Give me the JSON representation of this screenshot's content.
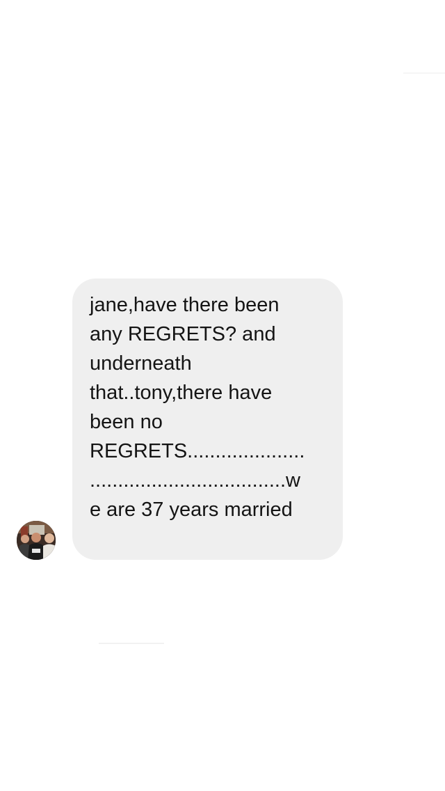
{
  "conversation": {
    "message": {
      "text": "jane,have there been any REGRETS? and underneath that..tony,there have been no REGRETS......................................................we are 37 years married",
      "lines": [
        "jane,have there been",
        "any REGRETS? and",
        "underneath",
        "that..tony,there have",
        "been no",
        "REGRETS.....................",
        "...................................w",
        "e are 37 years married"
      ],
      "sender_avatar_icon": "profile-photo"
    },
    "colors": {
      "background": "#ffffff",
      "bubble": "#efefef",
      "text": "#141414"
    }
  }
}
